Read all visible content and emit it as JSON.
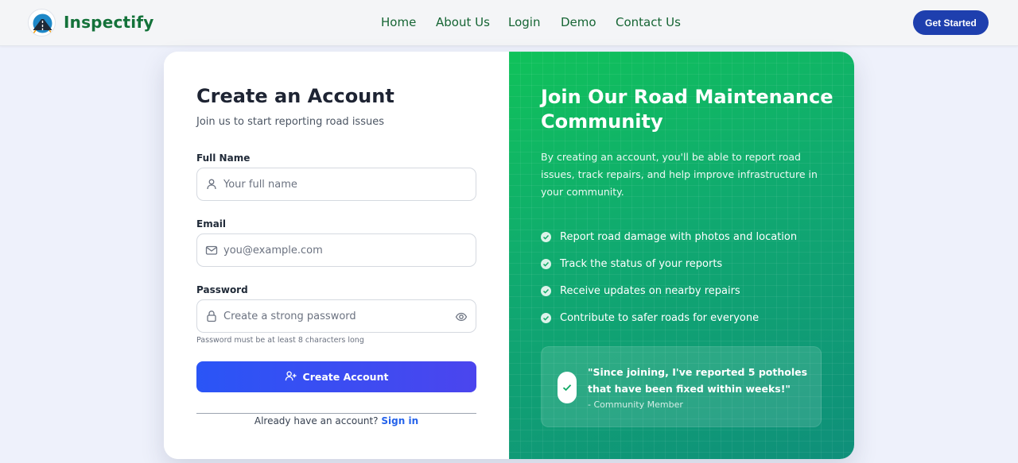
{
  "header": {
    "brand": "Inspectify",
    "nav": [
      "Home",
      "About Us",
      "Login",
      "Demo",
      "Contact Us"
    ],
    "cta_label": "Get Started"
  },
  "form": {
    "title": "Create an Account",
    "subtitle": "Join us to start reporting road issues",
    "full_name": {
      "label": "Full Name",
      "placeholder": "Your full name",
      "value": ""
    },
    "email": {
      "label": "Email",
      "placeholder": "you@example.com",
      "value": ""
    },
    "password": {
      "label": "Password",
      "placeholder": "Create a strong password",
      "value": "",
      "hint": "Password must be at least 8 characters long"
    },
    "submit_label": "Create Account",
    "signin_prompt": "Already have an account?",
    "signin_link": "Sign in"
  },
  "promo": {
    "title": "Join Our Road Maintenance Community",
    "description": "By creating an account, you'll be able to report road issues, track repairs, and help improve infrastructure in your community.",
    "features": [
      "Report road damage with photos and location",
      "Track the status of your reports",
      "Receive updates on nearby repairs",
      "Contribute to safer roads for everyone"
    ],
    "testimonial": {
      "quote": "\"Since joining, I've reported 5 potholes that have been fixed within weeks!\"",
      "author": "- Community Member"
    }
  },
  "colors": {
    "brand_green": "#14723a",
    "primary_blue": "#1e3fae",
    "button_gradient_start": "#2a55f6",
    "button_gradient_end": "#4b45ee",
    "promo_green": "#10c25a",
    "promo_teal": "#0f8f7a",
    "link_blue": "#2563eb"
  },
  "icons": {
    "logo": "road-logo-icon",
    "name_field": "user-icon",
    "email_field": "mail-icon",
    "password_field": "lock-icon",
    "password_toggle": "eye-icon",
    "submit": "user-plus-icon",
    "feature_bullet": "check-circle-icon",
    "testimonial": "check-icon"
  }
}
